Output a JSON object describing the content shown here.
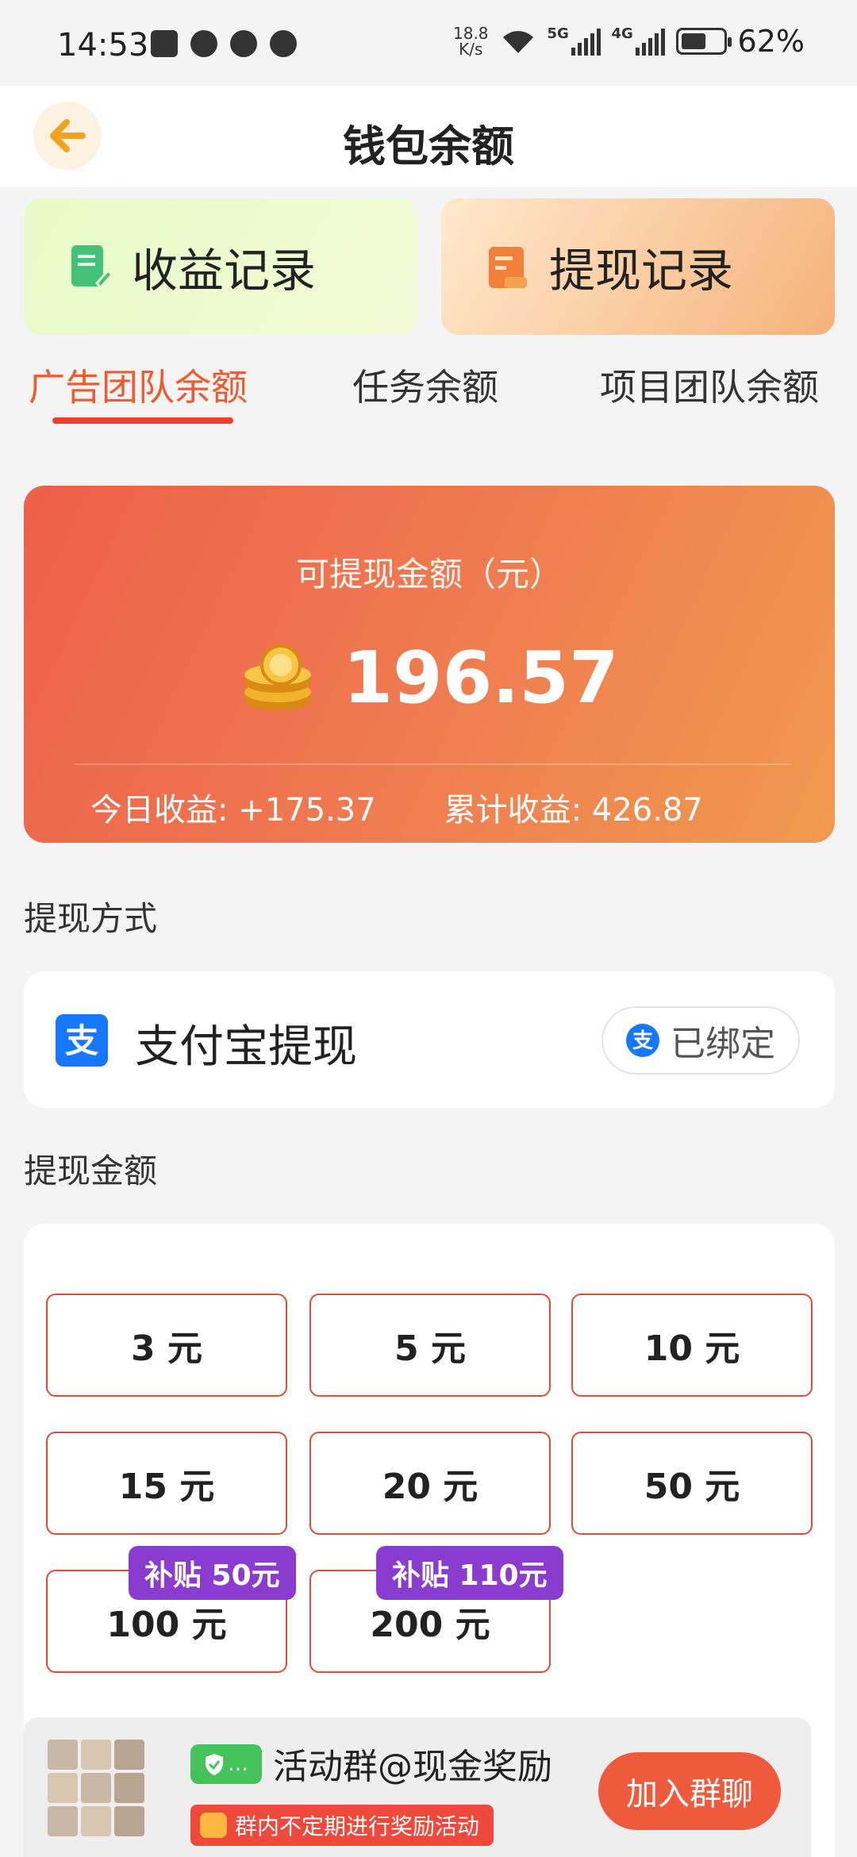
{
  "status_bar": {
    "time": "14:53",
    "net_speed_value": "18.8",
    "net_speed_unit": "K/s",
    "signal_1_tag": "5G",
    "signal_2_tag": "4G",
    "battery": "62%"
  },
  "header": {
    "title": "钱包余额",
    "back_icon": "arrow-left-icon"
  },
  "record_cards": {
    "income_label": "收益记录",
    "withdraw_label": "提现记录"
  },
  "tabs": [
    {
      "label": "广告团队余额",
      "active": true
    },
    {
      "label": "任务余额",
      "active": false
    },
    {
      "label": "项目团队余额",
      "active": false
    }
  ],
  "balance": {
    "label": "可提现金额（元）",
    "value": "196.57",
    "today_label": "今日收益:",
    "today_value": "+175.37",
    "total_label": "累计收益:",
    "total_value": "426.87"
  },
  "method_section": {
    "title": "提现方式",
    "method_label": "支付宝提现",
    "bound_label": "已绑定"
  },
  "amount_section": {
    "title": "提现金额",
    "options": [
      {
        "label": "3 元"
      },
      {
        "label": "5 元"
      },
      {
        "label": "10 元"
      },
      {
        "label": "15 元"
      },
      {
        "label": "20 元"
      },
      {
        "label": "50 元"
      },
      {
        "label": "100 元",
        "badge": "补贴 50元"
      },
      {
        "label": "200 元",
        "badge": "补贴 110元"
      }
    ]
  },
  "group_banner": {
    "wechat_tag": "…",
    "title": "活动群@现金奖励",
    "subtitle": "群内不定期进行奖励活动",
    "join_label": "加入群聊"
  },
  "colors": {
    "accent": "#ef5a2e",
    "balance_gradient_start": "#ee5f4a",
    "balance_gradient_end": "#f19a4e",
    "amount_border": "#e04a36",
    "badge": "#8a3bd0"
  }
}
